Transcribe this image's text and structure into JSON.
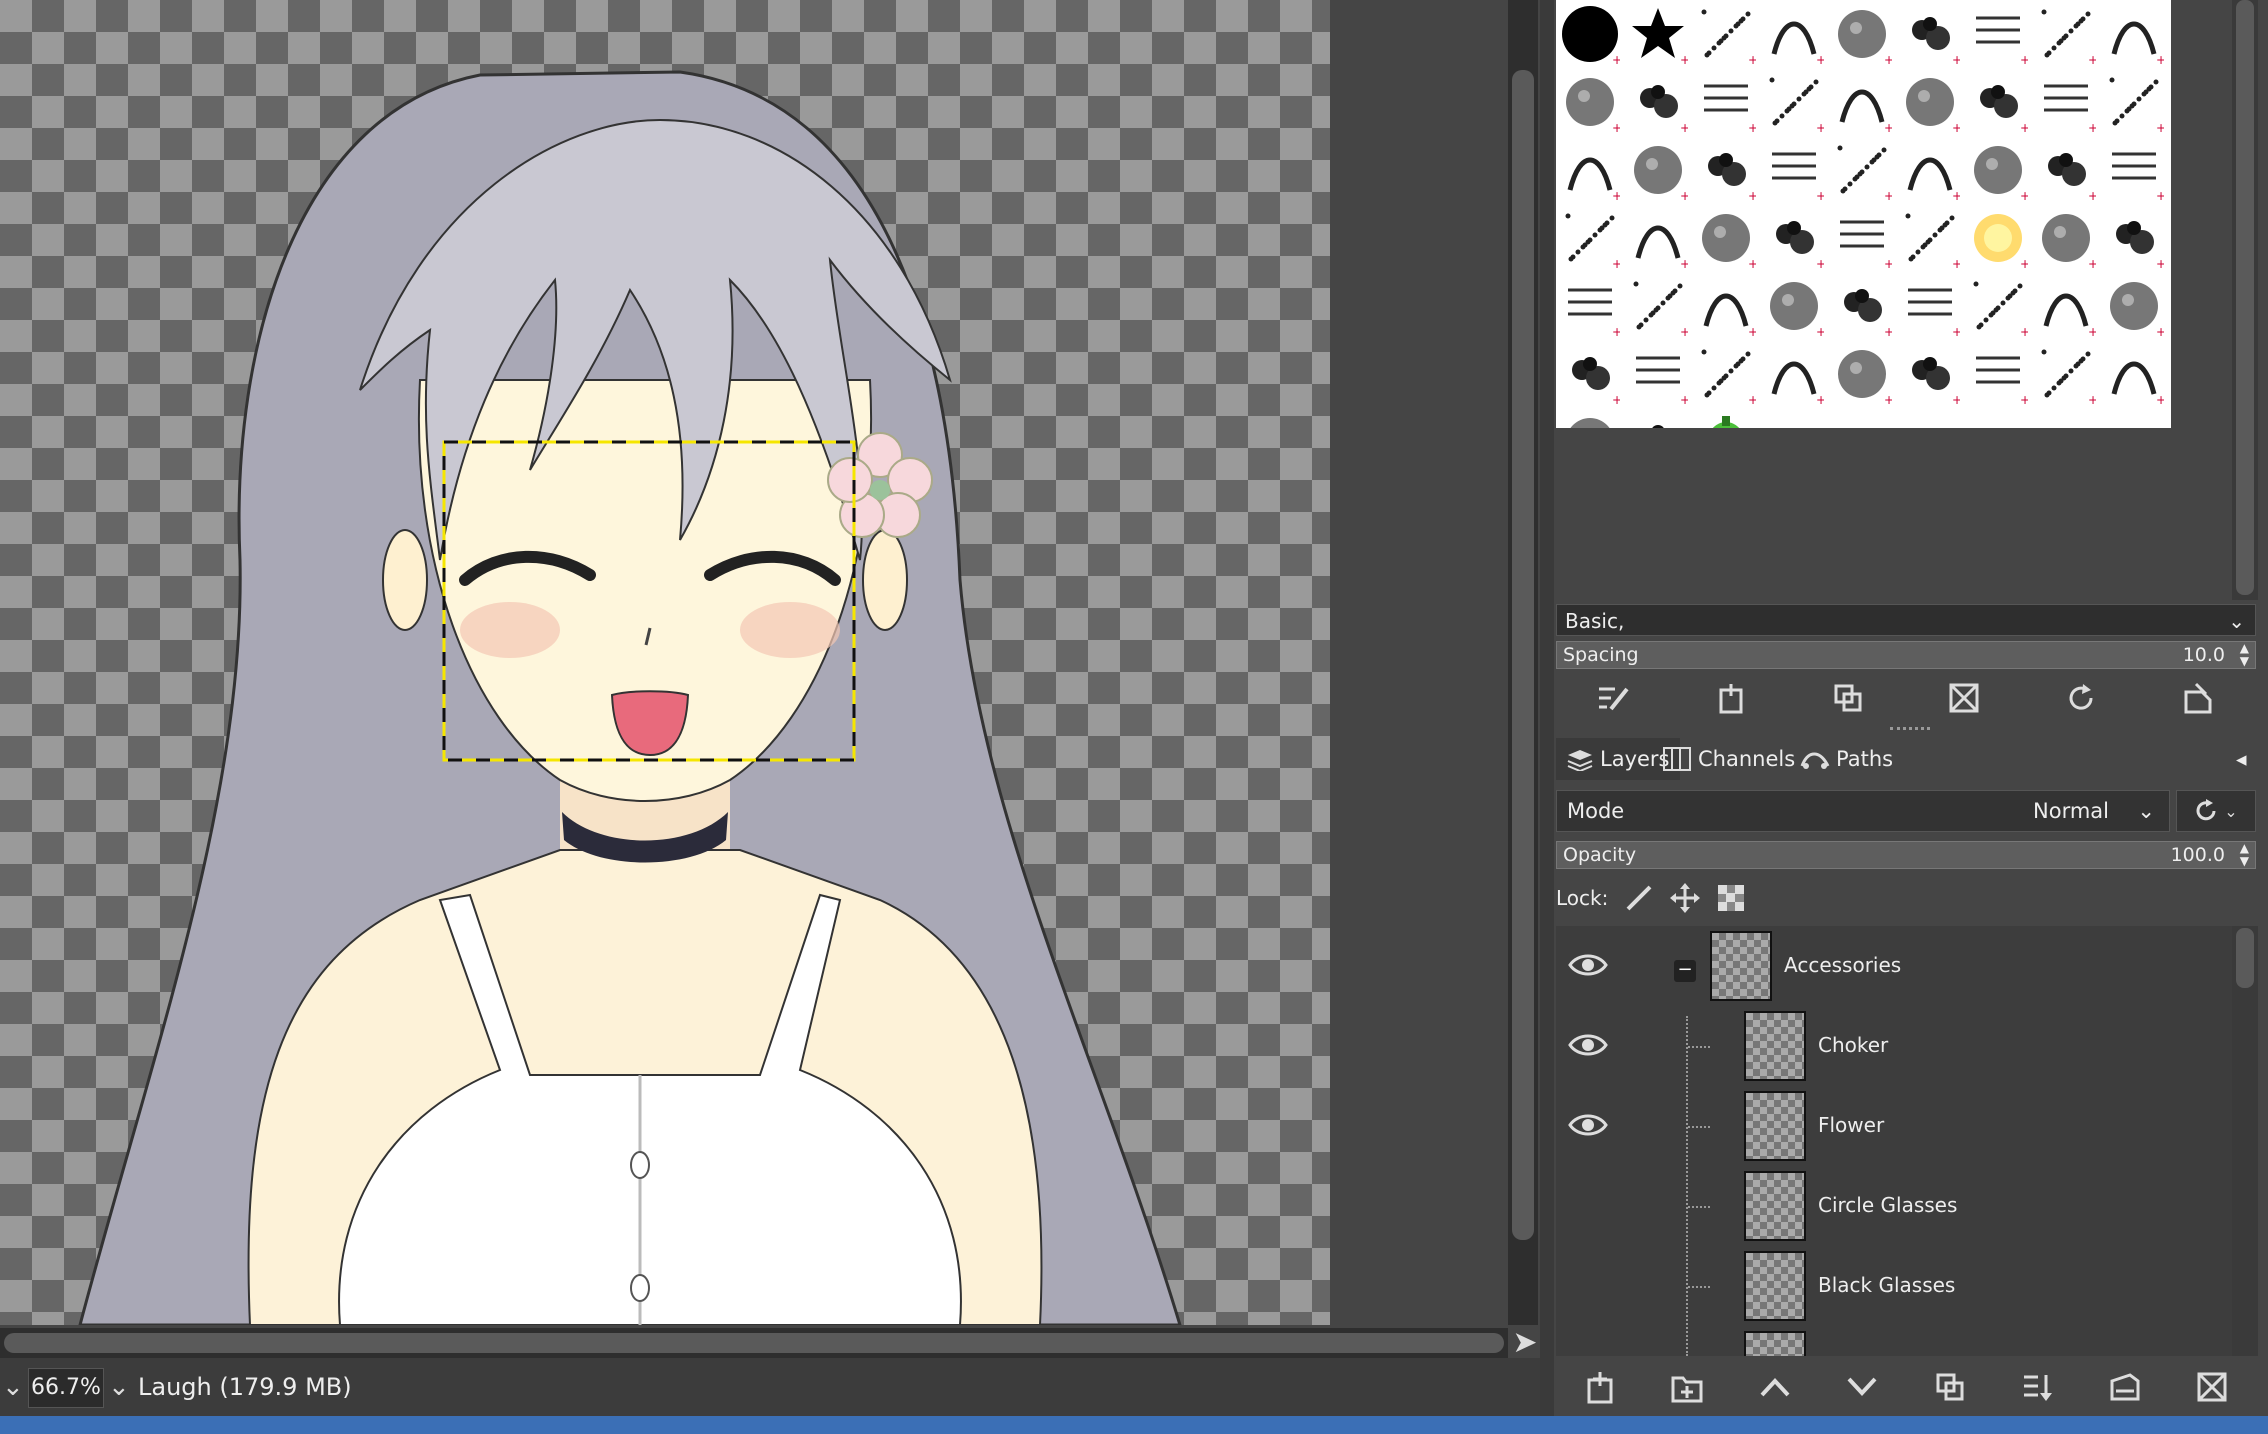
{
  "statusbar": {
    "zoom": "66.7%",
    "image_info": "Laugh (179.9 MB)"
  },
  "brushes": {
    "preset": "Basic,",
    "spacing_label": "Spacing",
    "spacing_value": "10.0"
  },
  "tabs": {
    "layers": "Layers",
    "channels": "Channels",
    "paths": "Paths"
  },
  "layer_options": {
    "mode_label": "Mode",
    "mode_value": "Normal",
    "opacity_label": "Opacity",
    "opacity_value": "100.0",
    "lock_label": "Lock:"
  },
  "layers": [
    {
      "name": "Accessories",
      "visible": true,
      "group": true
    },
    {
      "name": "Choker",
      "visible": true
    },
    {
      "name": "Flower",
      "visible": true
    },
    {
      "name": "Circle Glasses",
      "visible": false
    },
    {
      "name": "Black Glasses",
      "visible": false
    }
  ],
  "colors": {
    "selection": "#f5e600",
    "panel": "#454545",
    "canvas_bg": "#4a4a4a"
  }
}
